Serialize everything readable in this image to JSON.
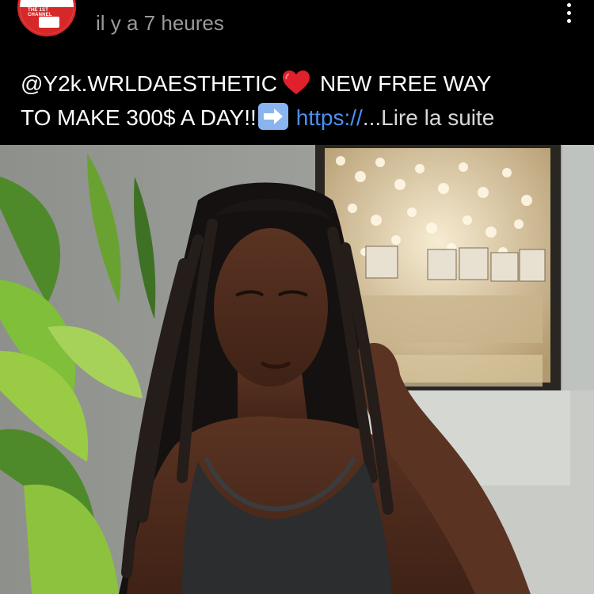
{
  "post": {
    "channel_logo_text": "THE 1ST CHANNEL",
    "time_ago": "il y a 7 heures",
    "caption": {
      "mention": "@Y2k.WRLDAESTHETIC",
      "line1_rest": "NEW FREE WAY",
      "line2": "TO MAKE 300$ A DAY!!",
      "link": "https://",
      "ellipsis": "...",
      "read_more": "Lire la suite"
    },
    "icons": {
      "more": "more-vertical-icon",
      "heart": "red-heart-emoji",
      "arrow": "right-arrow-emoji"
    },
    "colors": {
      "link": "#4a90f7",
      "timestamp": "#9a9a9a",
      "heart": "#e0202a",
      "arrow_box": "#8ab4f0"
    }
  }
}
